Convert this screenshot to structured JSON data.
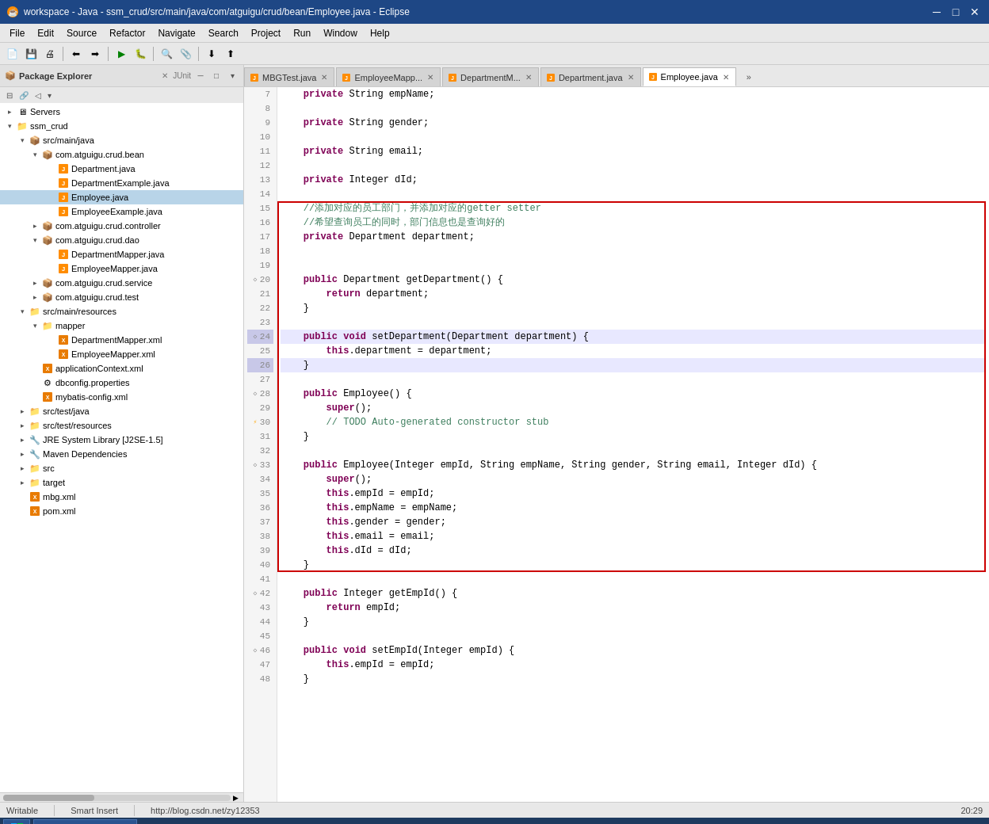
{
  "window": {
    "title": "workspace - Java - ssm_crud/src/main/java/com/atguigu/crud/bean/Employee.java - Eclipse",
    "minimize": "─",
    "maximize": "□",
    "close": "✕"
  },
  "menu": {
    "items": [
      "File",
      "Edit",
      "Source",
      "Refactor",
      "Navigate",
      "Search",
      "Project",
      "Run",
      "Window",
      "Help"
    ]
  },
  "panel": {
    "title": "Package Explorer",
    "tab2": "JUnit"
  },
  "tabs": [
    {
      "label": "MBGTest.java",
      "active": false,
      "modified": false
    },
    {
      "label": "EmployeeMapp...",
      "active": false,
      "modified": false
    },
    {
      "label": "DepartmentM...",
      "active": false,
      "modified": false
    },
    {
      "label": "Department.java",
      "active": false,
      "modified": false
    },
    {
      "label": "Employee.java",
      "active": true,
      "modified": false
    }
  ],
  "tree": [
    {
      "indent": 0,
      "toggle": "▸",
      "icon": "🖥",
      "label": "Servers",
      "type": "server"
    },
    {
      "indent": 0,
      "toggle": "▾",
      "icon": "📁",
      "label": "ssm_crud",
      "type": "project"
    },
    {
      "indent": 1,
      "toggle": "▾",
      "icon": "📦",
      "label": "src/main/java",
      "type": "folder"
    },
    {
      "indent": 2,
      "toggle": "▾",
      "icon": "📦",
      "label": "com.atguigu.crud.bean",
      "type": "package"
    },
    {
      "indent": 3,
      "toggle": "",
      "icon": "📄",
      "label": "Department.java",
      "type": "java"
    },
    {
      "indent": 3,
      "toggle": "",
      "icon": "📄",
      "label": "DepartmentExample.java",
      "type": "java"
    },
    {
      "indent": 3,
      "toggle": "",
      "icon": "📄",
      "label": "Employee.java",
      "type": "java",
      "selected": true
    },
    {
      "indent": 3,
      "toggle": "",
      "icon": "📄",
      "label": "EmployeeExample.java",
      "type": "java"
    },
    {
      "indent": 2,
      "toggle": "▾",
      "icon": "📦",
      "label": "com.atguigu.crud.controller",
      "type": "package"
    },
    {
      "indent": 2,
      "toggle": "▾",
      "icon": "📦",
      "label": "com.atguigu.crud.dao",
      "type": "package"
    },
    {
      "indent": 3,
      "toggle": "",
      "icon": "📄",
      "label": "DepartmentMapper.java",
      "type": "java"
    },
    {
      "indent": 3,
      "toggle": "",
      "icon": "📄",
      "label": "EmployeeMapper.java",
      "type": "java"
    },
    {
      "indent": 2,
      "toggle": "▸",
      "icon": "📦",
      "label": "com.atguigu.crud.service",
      "type": "package"
    },
    {
      "indent": 2,
      "toggle": "▸",
      "icon": "📦",
      "label": "com.atguigu.crud.test",
      "type": "package"
    },
    {
      "indent": 1,
      "toggle": "▾",
      "icon": "📁",
      "label": "src/main/resources",
      "type": "folder"
    },
    {
      "indent": 2,
      "toggle": "▾",
      "icon": "📁",
      "label": "mapper",
      "type": "folder"
    },
    {
      "indent": 3,
      "toggle": "",
      "icon": "📋",
      "label": "DepartmentMapper.xml",
      "type": "xml"
    },
    {
      "indent": 3,
      "toggle": "",
      "icon": "📋",
      "label": "EmployeeMapper.xml",
      "type": "xml"
    },
    {
      "indent": 2,
      "toggle": "",
      "icon": "📋",
      "label": "applicationContext.xml",
      "type": "xml"
    },
    {
      "indent": 2,
      "toggle": "",
      "icon": "⚙",
      "label": "dbconfig.properties",
      "type": "props"
    },
    {
      "indent": 2,
      "toggle": "",
      "icon": "📋",
      "label": "mybatis-config.xml",
      "type": "xml"
    },
    {
      "indent": 1,
      "toggle": "▸",
      "icon": "📁",
      "label": "src/test/java",
      "type": "folder"
    },
    {
      "indent": 1,
      "toggle": "▸",
      "icon": "📁",
      "label": "src/test/resources",
      "type": "folder"
    },
    {
      "indent": 1,
      "toggle": "▸",
      "icon": "🔧",
      "label": "JRE System Library [J2SE-1.5]",
      "type": "lib"
    },
    {
      "indent": 1,
      "toggle": "▸",
      "icon": "🔧",
      "label": "Maven Dependencies",
      "type": "lib"
    },
    {
      "indent": 1,
      "toggle": "▸",
      "icon": "📁",
      "label": "src",
      "type": "folder"
    },
    {
      "indent": 1,
      "toggle": "▸",
      "icon": "📁",
      "label": "target",
      "type": "folder"
    },
    {
      "indent": 1,
      "toggle": "",
      "icon": "📋",
      "label": "mbg.xml",
      "type": "xml"
    },
    {
      "indent": 1,
      "toggle": "",
      "icon": "📋",
      "label": "pom.xml",
      "type": "xml"
    }
  ],
  "code": {
    "lines": [
      {
        "num": 7,
        "fold": "",
        "text": "    private String empName;",
        "highlight": false
      },
      {
        "num": 8,
        "fold": "",
        "text": "",
        "highlight": false
      },
      {
        "num": 9,
        "fold": "",
        "text": "    private String gender;",
        "highlight": false
      },
      {
        "num": 10,
        "fold": "",
        "text": "",
        "highlight": false
      },
      {
        "num": 11,
        "fold": "",
        "text": "    private String email;",
        "highlight": false
      },
      {
        "num": 12,
        "fold": "",
        "text": "",
        "highlight": false
      },
      {
        "num": 13,
        "fold": "",
        "text": "    private Integer dId;",
        "highlight": false
      },
      {
        "num": 14,
        "fold": "",
        "text": "",
        "highlight": false
      },
      {
        "num": 15,
        "fold": "",
        "text": "    //添加对应的员工部门，并添加对应的getter setter",
        "highlight": false,
        "comment": true
      },
      {
        "num": 16,
        "fold": "",
        "text": "    //希望查询员工的同时，部门信息也是查询好的",
        "highlight": false,
        "comment": true
      },
      {
        "num": 17,
        "fold": "",
        "text": "    private Department department;",
        "highlight": false
      },
      {
        "num": 18,
        "fold": "",
        "text": "",
        "highlight": false
      },
      {
        "num": 19,
        "fold": "",
        "text": "",
        "highlight": false
      },
      {
        "num": 20,
        "fold": "◇",
        "text": "    public Department getDepartment() {",
        "highlight": false
      },
      {
        "num": 21,
        "fold": "",
        "text": "        return department;",
        "highlight": false
      },
      {
        "num": 22,
        "fold": "",
        "text": "    }",
        "highlight": false
      },
      {
        "num": 23,
        "fold": "",
        "text": "",
        "highlight": false
      },
      {
        "num": 24,
        "fold": "◇",
        "text": "    public void setDepartment(Department department) {",
        "highlight": true
      },
      {
        "num": 25,
        "fold": "",
        "text": "        this.department = department;",
        "highlight": false
      },
      {
        "num": 26,
        "fold": "",
        "text": "    }",
        "highlight": true
      },
      {
        "num": 27,
        "fold": "",
        "text": "",
        "highlight": false
      },
      {
        "num": 28,
        "fold": "◇",
        "text": "    public Employee() {",
        "highlight": false
      },
      {
        "num": 29,
        "fold": "",
        "text": "        super();",
        "highlight": false
      },
      {
        "num": 30,
        "fold": "⚡",
        "text": "        // TODO Auto-generated constructor stub",
        "highlight": false,
        "comment": true
      },
      {
        "num": 31,
        "fold": "",
        "text": "    }",
        "highlight": false
      },
      {
        "num": 32,
        "fold": "",
        "text": "",
        "highlight": false
      },
      {
        "num": 33,
        "fold": "◇",
        "text": "    public Employee(Integer empId, String empName, String gender, String email, Integer dId) {",
        "highlight": false
      },
      {
        "num": 34,
        "fold": "",
        "text": "        super();",
        "highlight": false
      },
      {
        "num": 35,
        "fold": "",
        "text": "        this.empId = empId;",
        "highlight": false
      },
      {
        "num": 36,
        "fold": "",
        "text": "        this.empName = empName;",
        "highlight": false
      },
      {
        "num": 37,
        "fold": "",
        "text": "        this.gender = gender;",
        "highlight": false
      },
      {
        "num": 38,
        "fold": "",
        "text": "        this.email = email;",
        "highlight": false
      },
      {
        "num": 39,
        "fold": "",
        "text": "        this.dId = dId;",
        "highlight": false
      },
      {
        "num": 40,
        "fold": "",
        "text": "    }",
        "highlight": false
      },
      {
        "num": 41,
        "fold": "",
        "text": "",
        "highlight": false
      },
      {
        "num": 42,
        "fold": "◇",
        "text": "    public Integer getEmpId() {",
        "highlight": false
      },
      {
        "num": 43,
        "fold": "",
        "text": "        return empId;",
        "highlight": false
      },
      {
        "num": 44,
        "fold": "",
        "text": "    }",
        "highlight": false
      },
      {
        "num": 45,
        "fold": "",
        "text": "",
        "highlight": false
      },
      {
        "num": 46,
        "fold": "◇",
        "text": "    public void setEmpId(Integer empId) {",
        "highlight": false
      },
      {
        "num": 47,
        "fold": "",
        "text": "        this.empId = empId;",
        "highlight": false
      },
      {
        "num": 48,
        "fold": "",
        "text": "    }",
        "highlight": false
      }
    ]
  },
  "status": {
    "writable": "Writable",
    "insert": "Smart Insert",
    "location": "http://blog.csdn.net/zy12353",
    "time": "20:29"
  }
}
